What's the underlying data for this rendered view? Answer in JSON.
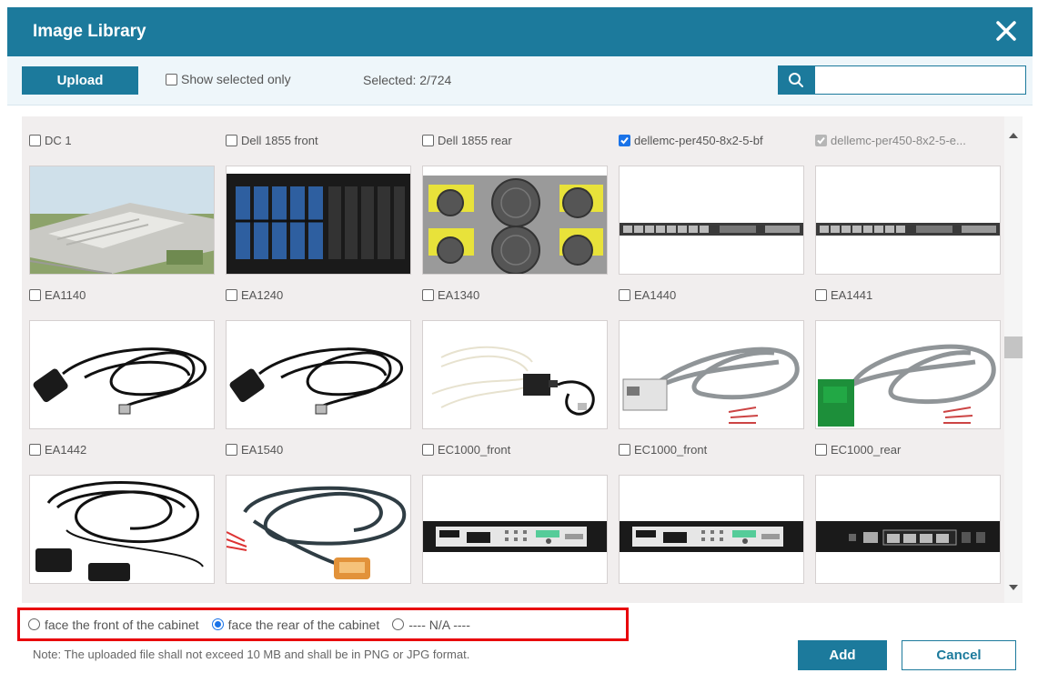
{
  "dialog": {
    "title": "Image Library"
  },
  "toolbar": {
    "upload_label": "Upload",
    "show_selected_label": "Show selected only",
    "selected_text": "Selected: 2/724",
    "search_value": ""
  },
  "images": [
    {
      "label": "DC 1",
      "checked": false,
      "art": "dc"
    },
    {
      "label": "Dell 1855 front",
      "checked": false,
      "art": "blade"
    },
    {
      "label": "Dell 1855 rear",
      "checked": false,
      "art": "fans"
    },
    {
      "label": "dellemc-per450-8x2-5-bf",
      "checked": true,
      "art": "rack1u"
    },
    {
      "label": "dellemc-per450-8x2-5-e...",
      "checked": true,
      "disabled": true,
      "art": "rack1u"
    },
    {
      "label": "EA1140",
      "checked": false,
      "art": "cable"
    },
    {
      "label": "EA1240",
      "checked": false,
      "art": "cable"
    },
    {
      "label": "EA1340",
      "checked": false,
      "art": "whitecable"
    },
    {
      "label": "EA1440",
      "checked": false,
      "art": "graycable-white"
    },
    {
      "label": "EA1441",
      "checked": false,
      "art": "graycable-green"
    },
    {
      "label": "EA1442",
      "checked": false,
      "art": "magcable"
    },
    {
      "label": "EA1540",
      "checked": false,
      "art": "leak"
    },
    {
      "label": "EC1000_front",
      "checked": false,
      "art": "ec"
    },
    {
      "label": "EC1000_front",
      "checked": false,
      "art": "ec"
    },
    {
      "label": "EC1000_rear",
      "checked": false,
      "art": "ecrear"
    }
  ],
  "orientation": {
    "options": [
      "face the front of the cabinet",
      "face the rear of the cabinet",
      "---- N/A ----"
    ],
    "selected": 1
  },
  "footer": {
    "note": "Note: The uploaded file shall not exceed 10 MB and shall be in PNG or JPG format.",
    "add_label": "Add",
    "cancel_label": "Cancel"
  },
  "colors": {
    "primary": "#1c7a9c",
    "highlight": "#e8000b",
    "check": "#1a73e8"
  }
}
